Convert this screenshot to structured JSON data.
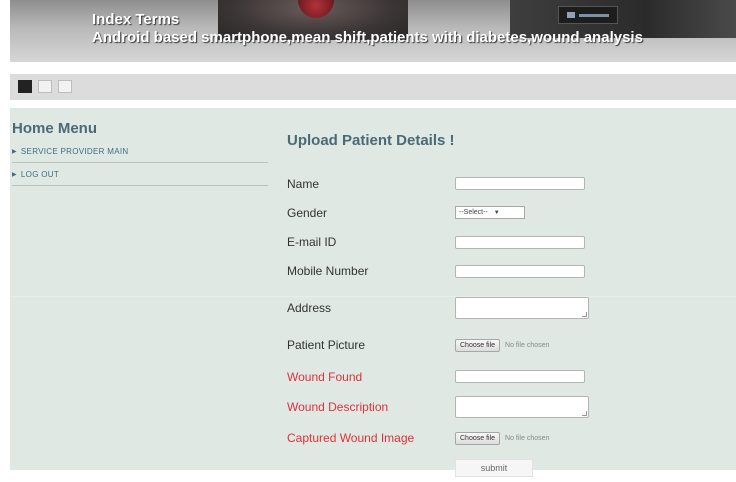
{
  "banner": {
    "title": "Index Terms",
    "subtitle": "Android based smartphone,mean shift,patients with diabetes,wound analysis"
  },
  "slider": {
    "dots": 3,
    "active_index": 0
  },
  "sidebar": {
    "title": "Home Menu",
    "items": [
      {
        "label": "SERVICE PROVIDER MAIN"
      },
      {
        "label": "LOG OUT"
      }
    ]
  },
  "form": {
    "title": "Upload Patient Details !",
    "fields": {
      "name": {
        "label": "Name",
        "value": ""
      },
      "gender": {
        "label": "Gender",
        "selected": "--Select--"
      },
      "email": {
        "label": "E-mail ID",
        "value": ""
      },
      "mobile": {
        "label": "Mobile Number",
        "value": ""
      },
      "address": {
        "label": "Address",
        "value": ""
      },
      "patient_picture": {
        "label": "Patient Picture",
        "button": "Choose file",
        "status": "No file chosen"
      },
      "wound_found": {
        "label": "Wound Found",
        "value": ""
      },
      "wound_description": {
        "label": "Wound Description",
        "value": ""
      },
      "captured_wound_image": {
        "label": "Captured Wound Image",
        "button": "Choose file",
        "status": "No file chosen"
      }
    },
    "submit_label": "submit"
  },
  "colors": {
    "accent_text": "#4a6a76",
    "required_label": "#e0313a",
    "content_bg": "#dfe8e2"
  }
}
